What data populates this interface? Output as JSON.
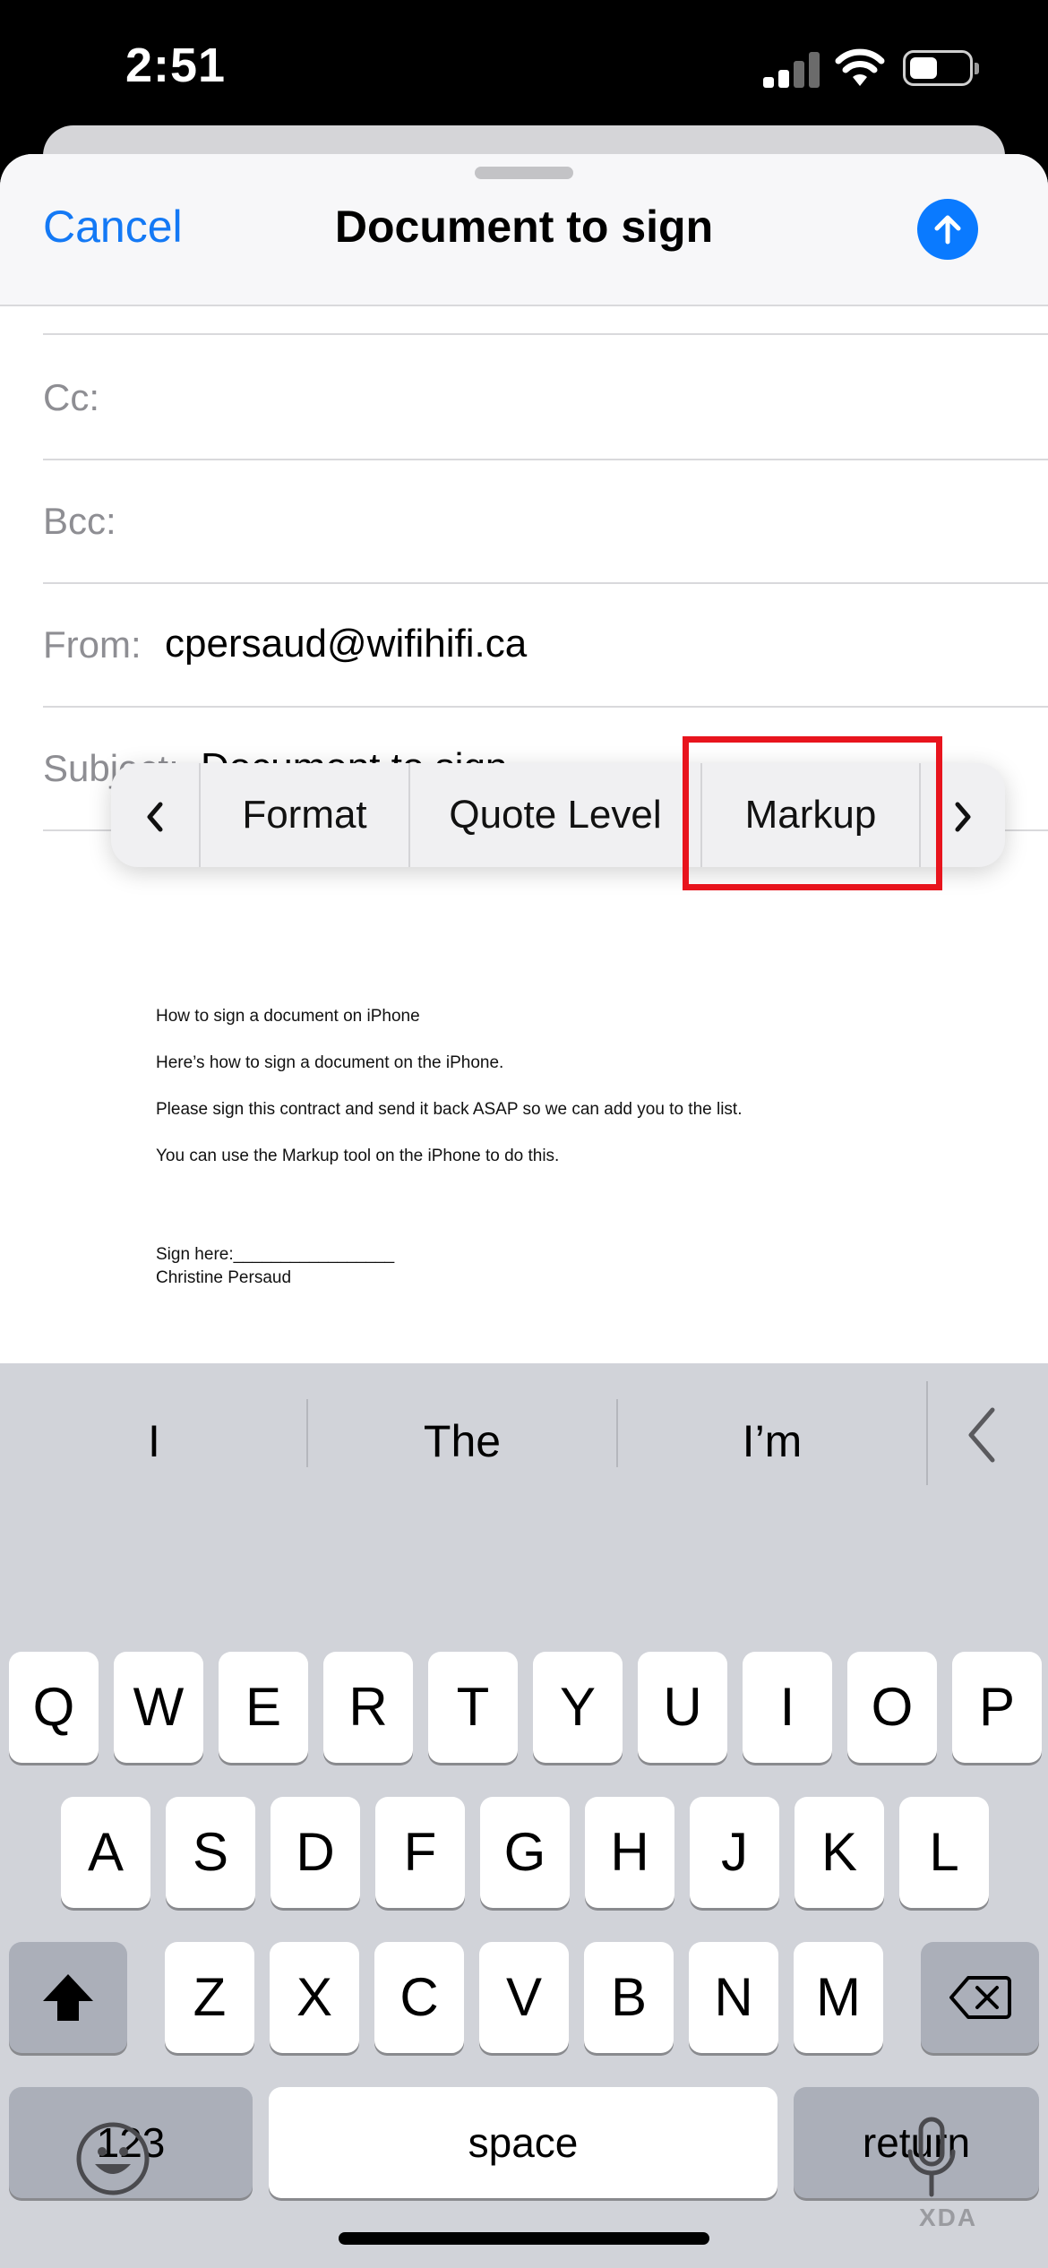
{
  "status": {
    "time": "2:51"
  },
  "compose": {
    "cancel_label": "Cancel",
    "title": "Document to sign",
    "cc_label": "Cc:",
    "bcc_label": "Bcc:",
    "from_label": "From:",
    "from_value": "cpersaud@wifihifi.ca",
    "subject_label": "Subject:",
    "subject_value": "Document to sign"
  },
  "context_menu": {
    "items": [
      "Format",
      "Quote Level",
      "Markup"
    ],
    "highlighted": "Markup"
  },
  "document": {
    "lines": [
      "How to sign a document on iPhone",
      "Here’s how to sign a document on the iPhone.",
      "Please sign this contract and send it back ASAP so we can add you to the list.",
      "You can use the Markup tool on the iPhone to do this."
    ],
    "sign_line": "Sign here:_________________",
    "signer": "Christine Persaud"
  },
  "keyboard": {
    "suggestions": [
      "I",
      "The",
      "I’m"
    ],
    "row1": [
      "Q",
      "W",
      "E",
      "R",
      "T",
      "Y",
      "U",
      "I",
      "O",
      "P"
    ],
    "row2": [
      "A",
      "S",
      "D",
      "F",
      "G",
      "H",
      "J",
      "K",
      "L"
    ],
    "row3": [
      "Z",
      "X",
      "C",
      "V",
      "B",
      "N",
      "M"
    ],
    "numbers_label": "123",
    "space_label": "space",
    "return_label": "return"
  },
  "watermark": "XDA"
}
